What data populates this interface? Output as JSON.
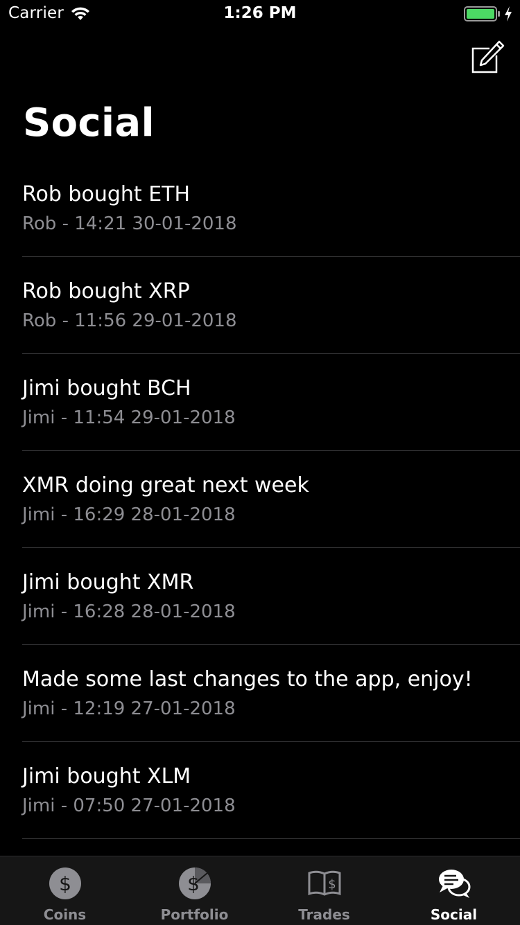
{
  "status_bar": {
    "carrier": "Carrier",
    "time": "1:26 PM",
    "battery_color": "#4cd964"
  },
  "header": {
    "title": "Social",
    "compose_icon": "compose-icon"
  },
  "feed": [
    {
      "message": "Rob bought ETH",
      "meta": "Rob - 14:21 30-01-2018"
    },
    {
      "message": "Rob bought XRP",
      "meta": "Rob - 11:56 29-01-2018"
    },
    {
      "message": "Jimi bought BCH",
      "meta": "Jimi - 11:54 29-01-2018"
    },
    {
      "message": "XMR doing great next week",
      "meta": "Jimi - 16:29 28-01-2018"
    },
    {
      "message": "Jimi bought XMR",
      "meta": "Jimi - 16:28 28-01-2018"
    },
    {
      "message": "Made some last changes to the app, enjoy!",
      "meta": "Jimi - 12:19 27-01-2018"
    },
    {
      "message": "Jimi bought XLM",
      "meta": "Jimi - 07:50 27-01-2018"
    }
  ],
  "tab_bar": {
    "active": "Social",
    "tabs": [
      {
        "label": "Coins",
        "icon": "coin-icon"
      },
      {
        "label": "Portfolio",
        "icon": "portfolio-icon"
      },
      {
        "label": "Trades",
        "icon": "book-icon"
      },
      {
        "label": "Social",
        "icon": "chat-bubbles-icon"
      }
    ]
  },
  "colors": {
    "background": "#000000",
    "secondary_text": "#8e8e93",
    "tab_bar": "#161616"
  }
}
